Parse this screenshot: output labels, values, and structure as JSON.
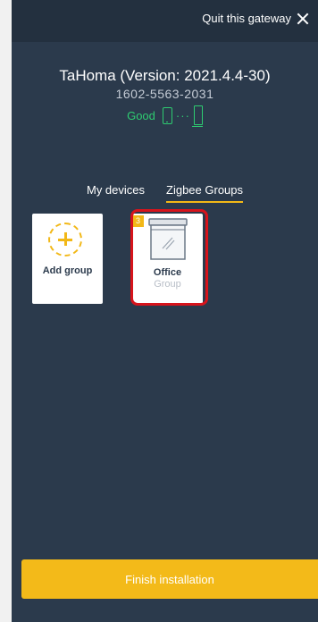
{
  "header": {
    "quit_label": "Quit this gateway"
  },
  "gateway": {
    "title": "TaHoma (Version: 2021.4.4-30)",
    "pin": "1602-5563-2031",
    "status": "Good"
  },
  "tabs": [
    {
      "label": "My devices",
      "active": false
    },
    {
      "label": "Zigbee Groups",
      "active": true
    }
  ],
  "cards": {
    "add": {
      "label": "Add group"
    },
    "office": {
      "label": "Office",
      "sublabel": "Group",
      "count": "3"
    }
  },
  "footer": {
    "finish_label": "Finish installation"
  },
  "colors": {
    "background": "#2b3a4c",
    "accent": "#f2b817",
    "status_good": "#2ecc71",
    "highlight": "#d7141c"
  },
  "icons": [
    "close-icon",
    "phone-icon",
    "connection-dots-icon",
    "gateway-box-icon",
    "add-circle-icon",
    "window-icon"
  ]
}
